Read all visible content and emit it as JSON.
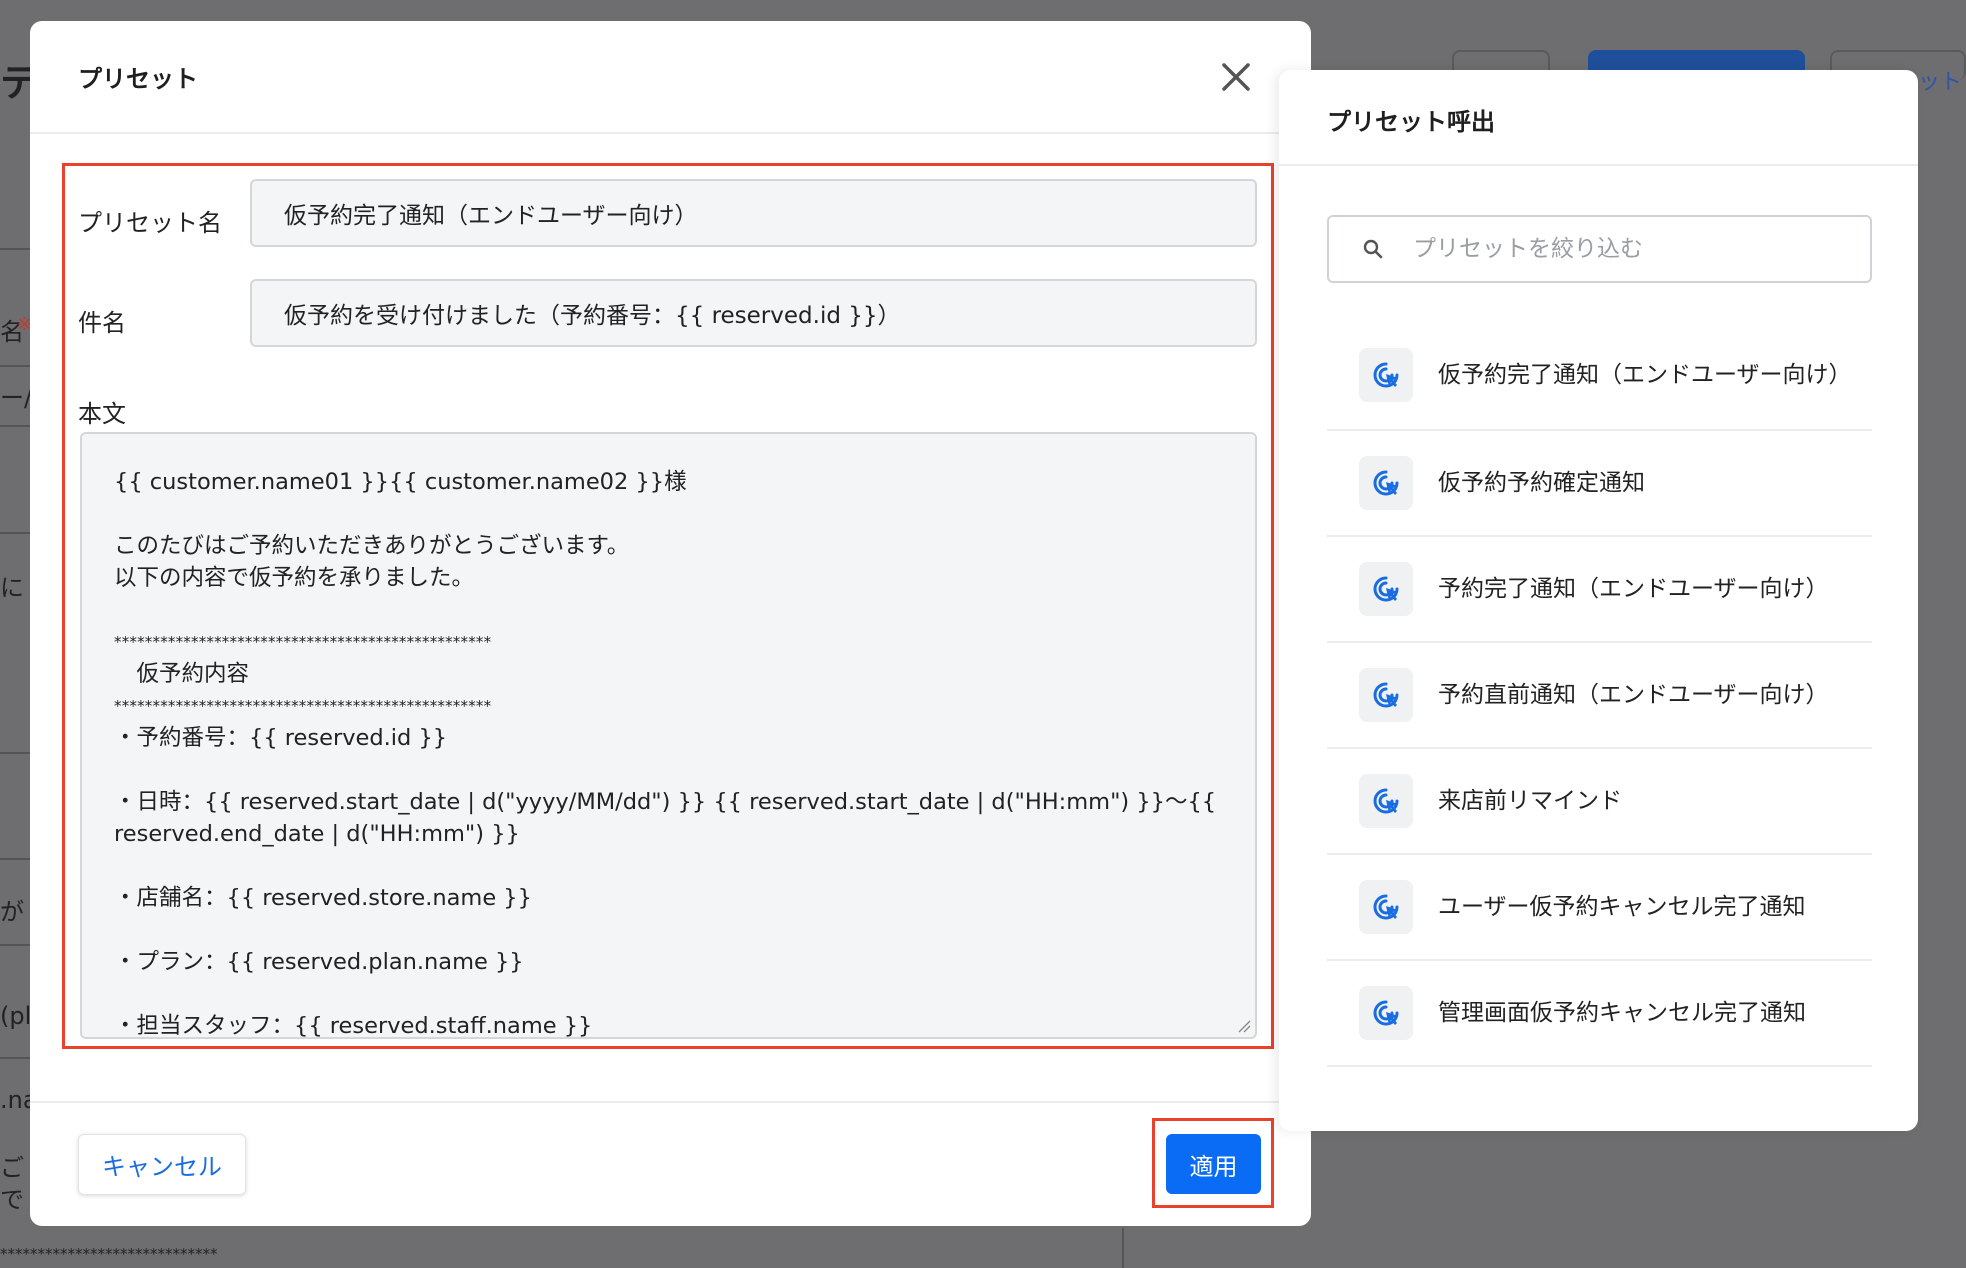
{
  "background": {
    "fragments": [
      "テ",
      "名",
      "ー/",
      "に",
      "が",
      "(pl",
      ".na",
      "ご",
      "で",
      "*****************************",
      "ット"
    ]
  },
  "modal": {
    "title": "プリセット",
    "close_label": "×",
    "preset_name_label": "プリセット名",
    "preset_name_value": "仮予約完了通知（エンドユーザー向け）",
    "subject_label": "件名",
    "subject_value": "仮予約を受け付けました（予約番号：{{ reserved.id }}）",
    "body_label": "本文",
    "body_lines": [
      "{{ customer.name01 }}{{ customer.name02 }}様",
      "",
      "このたびはご予約いただきありがとうございます。",
      "以下の内容で仮予約を承りました。",
      "",
      "*************************************************",
      "　仮予約内容",
      "*************************************************",
      "・予約番号：{{ reserved.id }}",
      "",
      "・日時：{{ reserved.start_date | d(\"yyyy/MM/dd\") }} {{ reserved.start_date | d(\"HH:mm\") }}〜{{",
      "reserved.end_date | d(\"HH:mm\") }}",
      "",
      "・店舗名：{{ reserved.store.name }}",
      "",
      "・プラン：{{ reserved.plan.name }}",
      "",
      "・担当スタッフ：{{ reserved.staff.name }}"
    ],
    "cancel_label": "キャンセル",
    "apply_label": "適用"
  },
  "panel": {
    "title": "プリセット呼出",
    "search_placeholder": "プリセットを絞り込む",
    "items": [
      {
        "label": "仮予約完了通知（エンドユーザー向け）",
        "icon": "cursor-click-icon"
      },
      {
        "label": "仮予約予約確定通知",
        "icon": "cursor-click-icon"
      },
      {
        "label": "予約完了通知（エンドユーザー向け）",
        "icon": "cursor-click-icon"
      },
      {
        "label": "予約直前通知（エンドユーザー向け）",
        "icon": "cursor-click-icon"
      },
      {
        "label": "来店前リマインド",
        "icon": "cursor-click-icon"
      },
      {
        "label": "ユーザー仮予約キャンセル完了通知",
        "icon": "cursor-click-icon"
      },
      {
        "label": "管理画面仮予約キャンセル完了通知",
        "icon": "cursor-click-icon"
      }
    ]
  },
  "colors": {
    "highlight": "#e8412c",
    "primary": "#0a6cf5",
    "link": "#1a6de0",
    "overlay": "#6e6e70"
  }
}
